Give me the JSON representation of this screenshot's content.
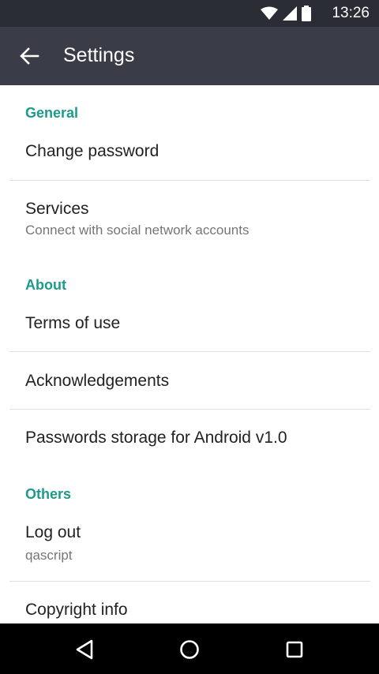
{
  "status_bar": {
    "time": "13:26",
    "icons": [
      "wifi-icon",
      "cell-signal-icon",
      "battery-icon"
    ]
  },
  "app_bar": {
    "title": "Settings",
    "back_icon": "arrow-back-icon"
  },
  "sections": [
    {
      "header": "General",
      "items": [
        {
          "title": "Change password"
        },
        {
          "title": "Services",
          "subtitle": "Connect with social network accounts"
        }
      ]
    },
    {
      "header": "About",
      "items": [
        {
          "title": "Terms of use"
        },
        {
          "title": "Acknowledgements"
        },
        {
          "title": "Passwords storage for Android v1.0"
        }
      ]
    },
    {
      "header": "Others",
      "items": [
        {
          "title": "Log out",
          "subtitle": "qascript"
        },
        {
          "title": "Copyright info"
        }
      ]
    }
  ],
  "nav_bar": {
    "buttons": [
      "back-triangle-icon",
      "home-circle-icon",
      "recents-square-icon"
    ]
  },
  "colors": {
    "accent": "#1d9a8a",
    "app_bar": "#3a3c48",
    "status_bar": "#2b2d36"
  }
}
